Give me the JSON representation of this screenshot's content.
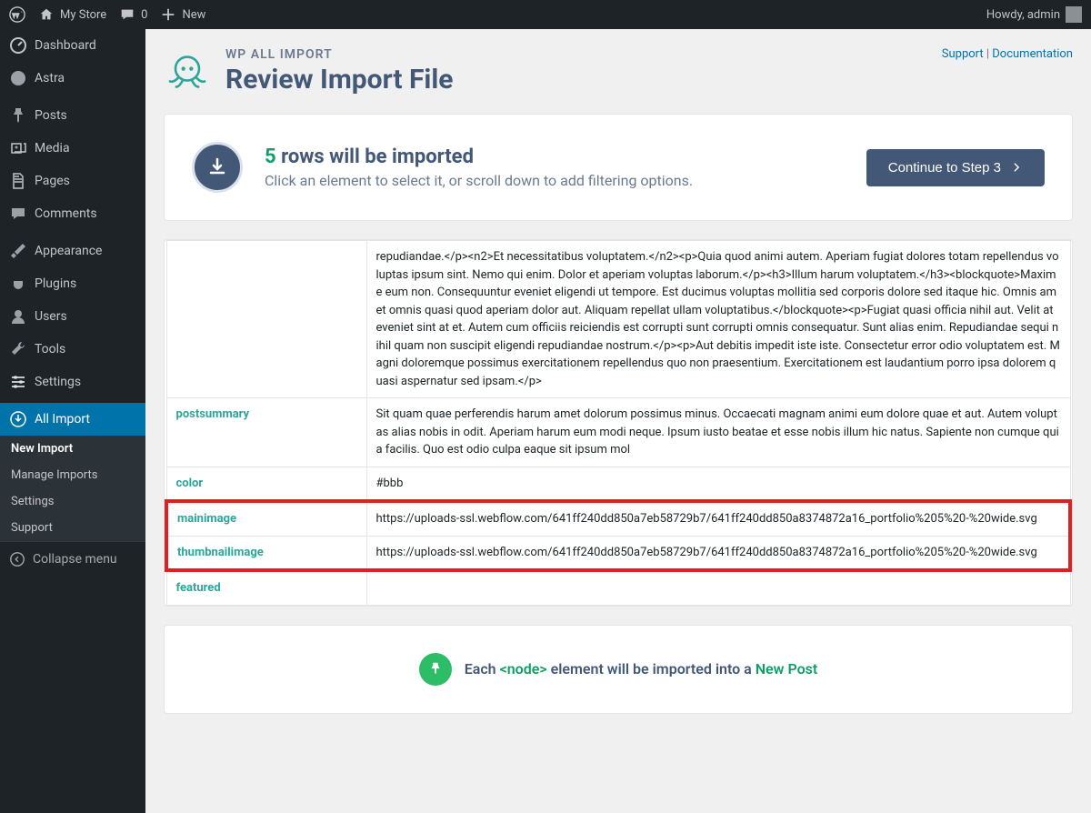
{
  "topbar": {
    "site_name": "My Store",
    "comments": "0",
    "new": "New",
    "greeting": "Howdy, admin"
  },
  "sidebar": {
    "items": [
      {
        "label": "Dashboard"
      },
      {
        "label": "Astra"
      },
      {
        "label": "Posts"
      },
      {
        "label": "Media"
      },
      {
        "label": "Pages"
      },
      {
        "label": "Comments"
      },
      {
        "label": "Appearance"
      },
      {
        "label": "Plugins"
      },
      {
        "label": "Users"
      },
      {
        "label": "Tools"
      },
      {
        "label": "Settings"
      },
      {
        "label": "All Import"
      }
    ],
    "sub": [
      {
        "label": "New Import"
      },
      {
        "label": "Manage Imports"
      },
      {
        "label": "Settings"
      },
      {
        "label": "Support"
      }
    ],
    "collapse": "Collapse menu"
  },
  "header": {
    "plugin": "WP ALL IMPORT",
    "title": "Review Import File",
    "support": "Support",
    "documentation": "Documentation",
    "sep": " | "
  },
  "summary": {
    "count": "5",
    "rows_text": " rows will be imported",
    "sub": "Click an element to select it, or scroll down to add filtering options.",
    "continue": "Continue to Step 3"
  },
  "rows": [
    {
      "key": "",
      "value": "repudiandae.</p><n2>Et necessitatibus voluptatem.</n2><p>Quia quod animi autem. Aperiam fugiat dolores totam repellendus voluptas ipsum sint. Nemo qui enim. Dolor et aperiam voluptas laborum.</p><h3>Illum harum voluptatem.</h3><blockquote>Maxime eum non. Consequuntur eveniet eligendi ut tempore. Est ducimus voluptas mollitia sed corporis dolore sed itaque hic. Omnis amet omnis quasi quod aperiam dolor aut. Aliquam repellat ullam voluptatibus.</blockquote><p>Fugiat quasi officia nihil aut. Velit at eveniet sint at et. Autem cum officiis reiciendis est corrupti sunt corrupti omnis consequatur. Sunt alias enim. Repudiandae sequi nihil quam non suscipit eligendi repudiandae nostrum.</p><p>Aut debitis impedit iste iste. Consectetur error odio voluptatem est. Magni doloremque possimus exercitationem repellendus quo non praesentium. Exercitationem est laudantium porro ipsa dolorem quasi aspernatur sed ipsam.</p>"
    },
    {
      "key": "postsummary",
      "value": "Sit quam quae perferendis harum amet dolorum possimus minus. Occaecati magnam animi eum dolore quae et aut. Autem voluptas alias nobis in odit. Aperiam harum eum modi neque. Ipsum iusto beatae et esse nobis illum hic natus. Sapiente non cumque quia facilis. Quo est odio culpa eaque sit ipsum mol"
    },
    {
      "key": "mainimage",
      "value": "https://uploads-ssl.webflow.com/641ff240dd850a7eb58729b7/641ff240dd850a8374872a16_portfolio%205%20-%20wide.svg",
      "hl": true
    },
    {
      "key": "thumbnailimage",
      "value": "https://uploads-ssl.webflow.com/641ff240dd850a7eb58729b7/641ff240dd850a8374872a16_portfolio%205%20-%20wide.svg",
      "hl": true
    },
    {
      "key": "featured",
      "value": ""
    },
    {
      "key": "color",
      "value": "#bbb"
    }
  ],
  "bottom": {
    "each": "Each ",
    "node": "<node>",
    "will": " element will be imported into a ",
    "newpost": "New Post"
  }
}
